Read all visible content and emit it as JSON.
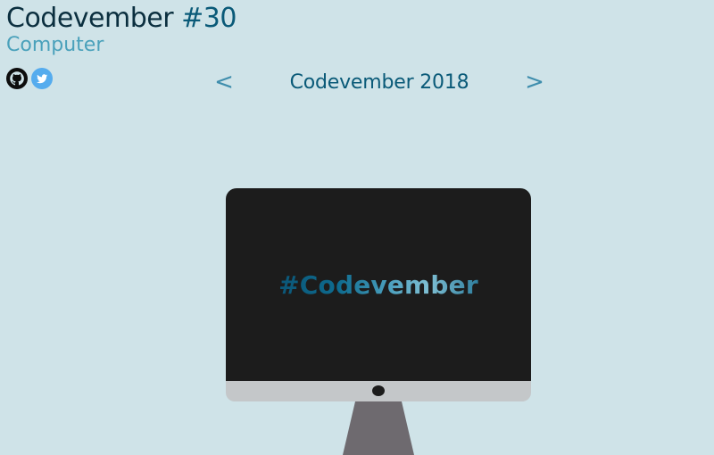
{
  "header": {
    "title_prefix": "Codevember",
    "title_number": "#30",
    "subtitle": "Computer"
  },
  "social": {
    "github_icon": "github-icon",
    "twitter_icon": "twitter-icon"
  },
  "nav": {
    "prev_label": "<",
    "title": "Codevember 2018",
    "next_label": ">"
  },
  "computer": {
    "screen_text": "#Codevember"
  },
  "colors": {
    "background": "#cfe3e8",
    "title": "#0b2f3f",
    "accent": "#0a5a78",
    "subtitle": "#4aa1bb",
    "twitter": "#55acee",
    "screen": "#1c1c1c",
    "chin": "#c4c7c9",
    "stand": "#6e6a6f"
  }
}
